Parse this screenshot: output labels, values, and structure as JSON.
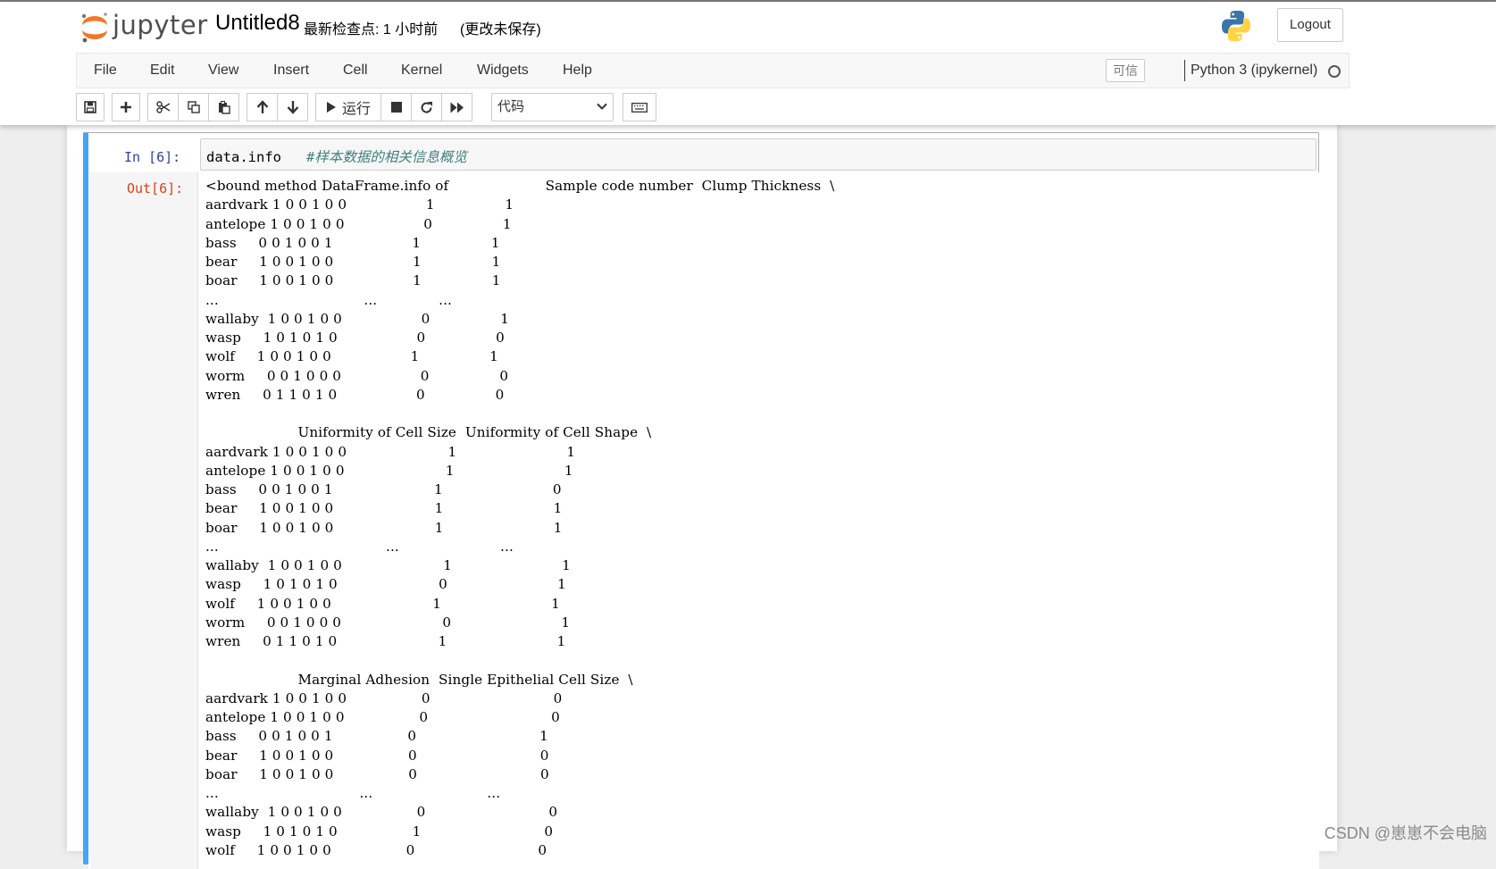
{
  "header": {
    "logo_text": "jupyter",
    "notebook_title": "Untitled8",
    "checkpoint": "最新检查点: 1 小时前",
    "autosave": "(更改未保存)",
    "logout_label": "Logout"
  },
  "menubar": {
    "items": [
      "File",
      "Edit",
      "View",
      "Insert",
      "Cell",
      "Kernel",
      "Widgets",
      "Help"
    ],
    "trusted_label": "可信",
    "kernel_name": "Python 3 (ipykernel)"
  },
  "toolbar": {
    "run_label": "运行",
    "cell_type": "代码"
  },
  "cell": {
    "in_prompt": "In  [6]:",
    "code": "data.info",
    "code_comment": "#样本数据的相关信息概览",
    "out_prompt": "Out[6]:",
    "output_lines": [
      "<bound method DataFrame.info of                      Sample code number  Clump Thickness  \\",
      "aardvark 1 0 0 1 0 0                  1                1",
      "antelope 1 0 0 1 0 0                  0                1",
      "bass     0 0 1 0 0 1                  1                1",
      "bear     1 0 0 1 0 0                  1                1",
      "boar     1 0 0 1 0 0                  1                1",
      "...                                 ...              ...",
      "wallaby  1 0 0 1 0 0                  0                1",
      "wasp     1 0 1 0 1 0                  0                0",
      "wolf     1 0 0 1 0 0                  1                1",
      "worm     0 0 1 0 0 0                  0                0",
      "wren     0 1 1 0 1 0                  0                0",
      "",
      "                     Uniformity of Cell Size  Uniformity of Cell Shape  \\",
      "aardvark 1 0 0 1 0 0                       1                         1",
      "antelope 1 0 0 1 0 0                       1                         1",
      "bass     0 0 1 0 0 1                       1                         0",
      "bear     1 0 0 1 0 0                       1                         1",
      "boar     1 0 0 1 0 0                       1                         1",
      "...                                      ...                       ...",
      "wallaby  1 0 0 1 0 0                       1                         1",
      "wasp     1 0 1 0 1 0                       0                         1",
      "wolf     1 0 0 1 0 0                       1                         1",
      "worm     0 0 1 0 0 0                       0                         1",
      "wren     0 1 1 0 1 0                       1                         1",
      "",
      "                     Marginal Adhesion  Single Epithelial Cell Size  \\",
      "aardvark 1 0 0 1 0 0                 0                            0",
      "antelope 1 0 0 1 0 0                 0                            0",
      "bass     0 0 1 0 0 1                 0                            1",
      "bear     1 0 0 1 0 0                 0                            0",
      "boar     1 0 0 1 0 0                 0                            0",
      "...                                ...                          ...",
      "wallaby  1 0 0 1 0 0                 0                            0",
      "wasp     1 0 1 0 1 0                 1                            0",
      "wolf     1 0 0 1 0 0                 0                            0"
    ]
  },
  "watermark": "CSDN @崽崽不会电脑",
  "colors": {
    "selected_cell_border": "#42a5f5",
    "in_prompt": "#303f9f",
    "out_prompt": "#d84315",
    "comment": "#408080"
  }
}
